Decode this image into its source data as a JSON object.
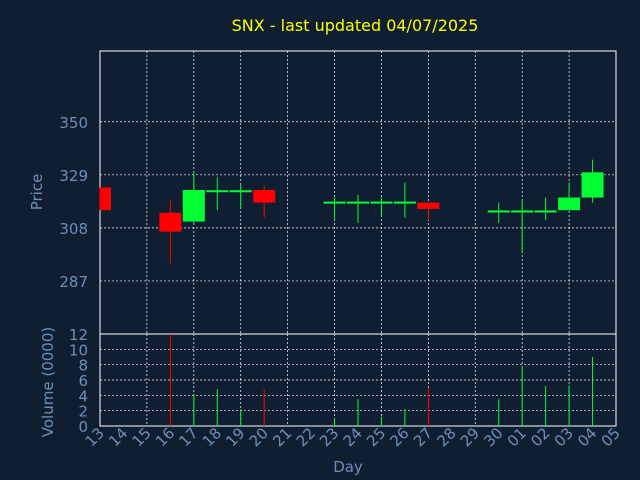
{
  "chart_data": [
    {
      "type": "candlestick",
      "title": "SNX - last updated 04/07/2025",
      "ylabel": "Price",
      "ylim": [
        266,
        378
      ],
      "yticks": [
        287,
        308,
        329,
        350
      ],
      "grid": true,
      "colors": {
        "up": "#00ff33",
        "down": "#ff0000",
        "title": "#ffff00",
        "axis_text": "#6f8fb8",
        "grid": "#ffffff",
        "background": "#0f1f31"
      },
      "candles": [
        {
          "day": "13",
          "open": 324,
          "close": 315,
          "high": 324,
          "low": 315
        },
        {
          "day": "16",
          "open": 314,
          "close": 306.5,
          "high": 319,
          "low": 294
        },
        {
          "day": "17",
          "open": 310.5,
          "close": 323,
          "high": 330,
          "low": 310
        },
        {
          "day": "18",
          "open": 322.5,
          "close": 322.5,
          "high": 328,
          "low": 315
        },
        {
          "day": "19",
          "open": 322.5,
          "close": 322.5,
          "high": 325,
          "low": 316
        },
        {
          "day": "20",
          "open": 323,
          "close": 318,
          "high": 325,
          "low": 312
        },
        {
          "day": "23",
          "open": 318,
          "close": 318,
          "high": 320,
          "low": 311
        },
        {
          "day": "24",
          "open": 318,
          "close": 318,
          "high": 321,
          "low": 310
        },
        {
          "day": "25",
          "open": 318,
          "close": 318,
          "high": 320,
          "low": 313
        },
        {
          "day": "26",
          "open": 318,
          "close": 318,
          "high": 326,
          "low": 312
        },
        {
          "day": "27",
          "open": 318,
          "close": 315.5,
          "high": 318,
          "low": 311
        },
        {
          "day": "30",
          "open": 314.5,
          "close": 314.5,
          "high": 318,
          "low": 310
        },
        {
          "day": "01",
          "open": 314.5,
          "close": 314.5,
          "high": 319,
          "low": 298
        },
        {
          "day": "02",
          "open": 314.5,
          "close": 314.5,
          "high": 320,
          "low": 311
        },
        {
          "day": "03",
          "open": 315,
          "close": 320,
          "high": 326,
          "low": 315
        },
        {
          "day": "04",
          "open": 320,
          "close": 330,
          "high": 335,
          "low": 318
        }
      ]
    },
    {
      "type": "bar",
      "ylabel": "Volume (0000)",
      "ylim": [
        0,
        12
      ],
      "yticks": [
        0,
        2,
        4,
        6,
        8,
        10,
        12
      ],
      "xlabel": "Day",
      "x_tick_labels": [
        "13",
        "14",
        "15",
        "16",
        "17",
        "18",
        "19",
        "20",
        "21",
        "22",
        "23",
        "24",
        "25",
        "26",
        "27",
        "28",
        "29",
        "30",
        "01",
        "02",
        "03",
        "04",
        "05"
      ],
      "volumes": [
        {
          "day": "16",
          "value": 12,
          "color": "#ff0000"
        },
        {
          "day": "17",
          "value": 4.2,
          "color": "#00ff33"
        },
        {
          "day": "18",
          "value": 4.8,
          "color": "#00ff33"
        },
        {
          "day": "19",
          "value": 2.2,
          "color": "#00ff33"
        },
        {
          "day": "20",
          "value": 4.8,
          "color": "#ff0000"
        },
        {
          "day": "23",
          "value": 1.0,
          "color": "#00ff33"
        },
        {
          "day": "24",
          "value": 3.5,
          "color": "#00ff33"
        },
        {
          "day": "25",
          "value": 1.2,
          "color": "#00ff33"
        },
        {
          "day": "26",
          "value": 2.2,
          "color": "#00ff33"
        },
        {
          "day": "27",
          "value": 5.0,
          "color": "#ff0000"
        },
        {
          "day": "30",
          "value": 3.5,
          "color": "#00ff33"
        },
        {
          "day": "01",
          "value": 7.8,
          "color": "#00ff33"
        },
        {
          "day": "02",
          "value": 5.2,
          "color": "#00ff33"
        },
        {
          "day": "03",
          "value": 5.3,
          "color": "#00ff33"
        },
        {
          "day": "04",
          "value": 9.0,
          "color": "#00ff33"
        }
      ]
    }
  ]
}
